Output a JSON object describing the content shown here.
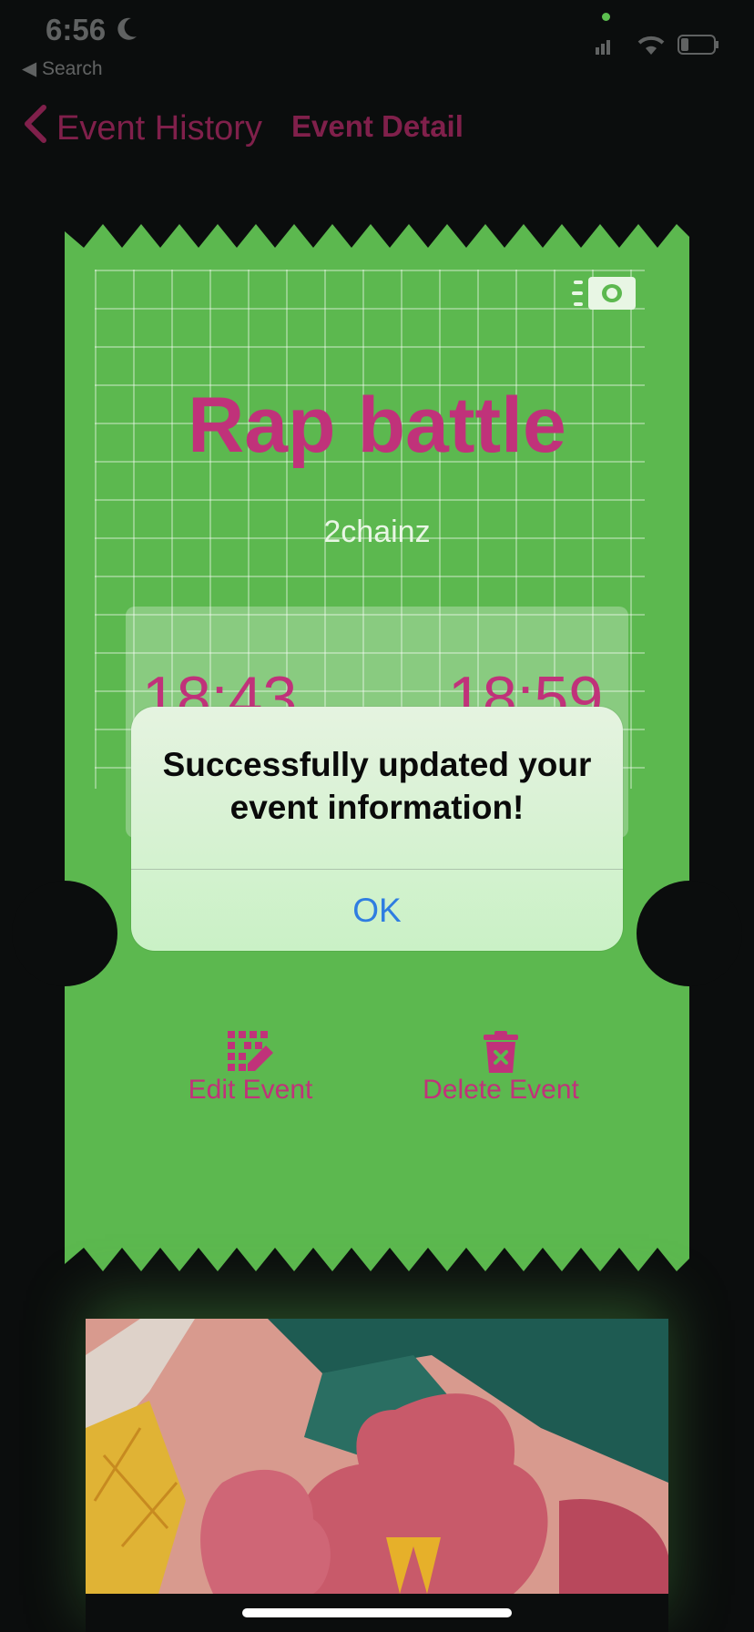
{
  "status_bar": {
    "time": "6:56",
    "back_app": "◀ Search"
  },
  "nav": {
    "back_label": "Event History",
    "title": "Event Detail"
  },
  "ticket": {
    "title": "Rap battle",
    "subtitle": "2chainz",
    "start_time": "18:43",
    "end_time": "18:59",
    "edit_label": "Edit Event",
    "delete_label": "Delete Event"
  },
  "alert": {
    "message": "Successfully updated your event information!",
    "ok_label": "OK"
  },
  "colors": {
    "ticket_green": "#5cb84f",
    "accent_pink": "#c0327a",
    "alert_button_blue": "#2f7de1",
    "background": "#0b0d0d"
  },
  "icons": {
    "money": "money-icon",
    "edit": "edit-event-icon",
    "delete": "trash-icon",
    "back": "chevron-left-icon"
  }
}
